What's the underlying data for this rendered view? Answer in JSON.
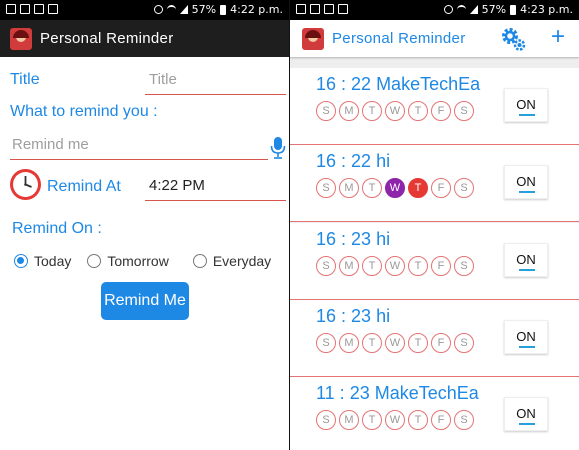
{
  "status": {
    "battery": "57%",
    "time_left": "4:22 p.m.",
    "time_right": "4:23 p.m."
  },
  "left": {
    "app_title": "Personal Reminder",
    "title_label": "Title",
    "title_placeholder": "Title",
    "remind_label": "What to remind you :",
    "remind_placeholder": "Remind me",
    "remind_at_label": "Remind At",
    "time_value": "4:22 PM",
    "remind_on_label": "Remind On :",
    "options": [
      "Today",
      "Tomorrow",
      "Everyday"
    ],
    "selected_option": "Today",
    "button_label": "Remind Me"
  },
  "right": {
    "app_title": "Personal Reminder",
    "day_letters": [
      "S",
      "M",
      "T",
      "W",
      "T",
      "F",
      "S"
    ],
    "reminders": [
      {
        "time": "16 : 22",
        "name": "MakeTechEa",
        "toggle": "ON",
        "active_days": []
      },
      {
        "time": "16 : 22",
        "name": "hi",
        "toggle": "ON",
        "active_days": [
          3,
          4
        ]
      },
      {
        "time": "16 : 23",
        "name": "hi",
        "toggle": "ON",
        "active_days": []
      },
      {
        "time": "16 : 23",
        "name": "hi",
        "toggle": "ON",
        "active_days": []
      },
      {
        "time": "11 : 23",
        "name": "MakeTechEa",
        "toggle": "ON",
        "active_days": []
      }
    ]
  },
  "colors": {
    "accent_blue": "#1e88e5",
    "underline_red": "#d9534f",
    "day_purple": "#8e24aa",
    "day_red": "#e53935"
  }
}
